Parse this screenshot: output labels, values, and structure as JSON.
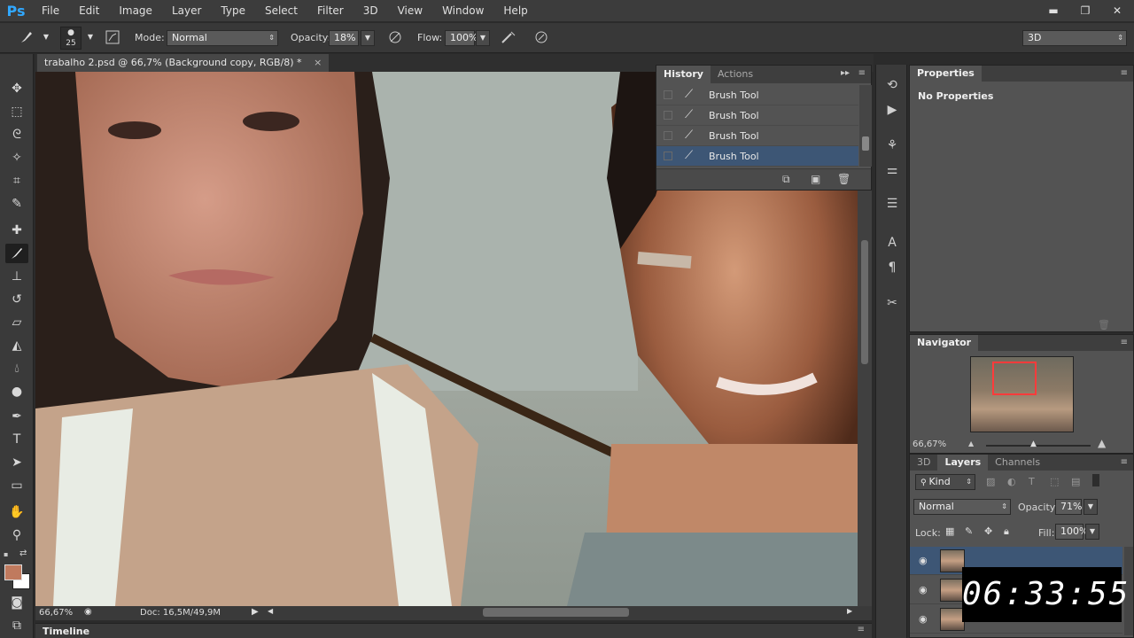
{
  "app": {
    "logo": "Ps"
  },
  "menu": [
    "File",
    "Edit",
    "Image",
    "Layer",
    "Type",
    "Select",
    "Filter",
    "3D",
    "View",
    "Window",
    "Help"
  ],
  "window_controls": {
    "minimize": "▬",
    "restore": "❐",
    "close": "✕"
  },
  "options": {
    "brush_size": "25",
    "mode_label": "Mode:",
    "mode_value": "Normal",
    "opacity_label": "Opacity:",
    "opacity_value": "18%",
    "flow_label": "Flow:",
    "flow_value": "100%",
    "workspace": "3D"
  },
  "document": {
    "tab_title": "trabalho 2.psd @ 66,7% (Background copy, RGB/8) *"
  },
  "status": {
    "zoom": "66,67%",
    "doc_info": "Doc: 16,5M/49,9M"
  },
  "timeline": {
    "label": "Timeline"
  },
  "history": {
    "tabs": [
      "History",
      "Actions"
    ],
    "items": [
      "Brush Tool",
      "Brush Tool",
      "Brush Tool",
      "Brush Tool"
    ],
    "selected_index": 3
  },
  "properties": {
    "title": "Properties",
    "body": "No Properties"
  },
  "navigator": {
    "title": "Navigator",
    "zoom": "66,67%"
  },
  "layers": {
    "tabs": [
      "3D",
      "Layers",
      "Channels"
    ],
    "filter_kind": "Kind",
    "blend_mode": "Normal",
    "opacity_label": "Opacity:",
    "opacity_value": "71%",
    "lock_label": "Lock:",
    "fill_label": "Fill:",
    "fill_value": "100%"
  },
  "timer": "06:33:55",
  "colors": {
    "foreground": "#c07a5e",
    "background": "#ffffff",
    "selection": "#3d5675"
  }
}
